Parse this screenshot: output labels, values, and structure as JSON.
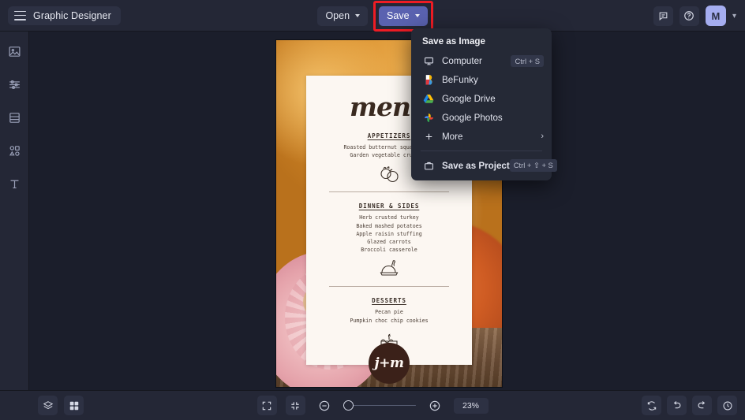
{
  "app": {
    "brand": "Graphic Designer",
    "hamburger_icon": "hamburger-menu-icon"
  },
  "toolbar": {
    "open_label": "Open",
    "save_label": "Save",
    "open_chevron_icon": "chevron-down-icon",
    "save_chevron_icon": "chevron-down-icon",
    "highlight_color": "#ee1c24",
    "save_button_color": "#5a62b0"
  },
  "header_right": {
    "feedback_icon": "comment-icon",
    "help_icon": "help-circle-icon",
    "avatar_initial": "M",
    "avatar_color": "#a5adf0",
    "avatar_chevron_icon": "chevron-down-icon"
  },
  "sidebar": {
    "items": [
      {
        "name": "image",
        "icon": "image-icon"
      },
      {
        "name": "edit",
        "icon": "sliders-icon"
      },
      {
        "name": "templates",
        "icon": "layout-icon"
      },
      {
        "name": "graphics",
        "icon": "shapes-icon"
      },
      {
        "name": "text",
        "icon": "text-icon"
      }
    ]
  },
  "save_menu": {
    "title": "Save as Image",
    "items": [
      {
        "label": "Computer",
        "icon": "monitor-icon",
        "shortcut": "Ctrl + S",
        "arrow": false,
        "bold": false
      },
      {
        "label": "BeFunky",
        "icon": "befunky-logo-icon",
        "shortcut": "",
        "arrow": false,
        "bold": false
      },
      {
        "label": "Google Drive",
        "icon": "google-drive-icon",
        "shortcut": "",
        "arrow": false,
        "bold": false
      },
      {
        "label": "Google Photos",
        "icon": "google-photos-icon",
        "shortcut": "",
        "arrow": false,
        "bold": false
      },
      {
        "label": "More",
        "icon": "plus-icon",
        "shortcut": "",
        "arrow": true,
        "bold": false
      }
    ],
    "project_item": {
      "label": "Save as Project",
      "icon": "briefcase-icon",
      "shortcut": "Ctrl + ⇧ + S"
    }
  },
  "design": {
    "title": "menu",
    "logo": "j+m",
    "sections": [
      {
        "heading": "APPETIZERS",
        "lines": "Roasted butternut squash soup\nGarden vegetable crudites",
        "icon": "squash-vegetables-icon"
      },
      {
        "heading": "DINNER & SIDES",
        "lines": "Herb crusted turkey\nBaked mashed potatoes\nApple raisin stuffing\nGlazed carrots\nBroccoli casserole",
        "icon": "roast-turkey-icon"
      },
      {
        "heading": "DESSERTS",
        "lines": "Pecan pie\nPumpkin choc chip cookies",
        "icon": "cake-icon"
      }
    ]
  },
  "bottombar": {
    "layers_icon": "layers-icon",
    "grid_icon": "grid-icon",
    "fit_icon": "fit-screen-icon",
    "collapse_icon": "collapse-screen-icon",
    "zoom_out_icon": "zoom-out-icon",
    "zoom_in_icon": "zoom-in-icon",
    "zoom_level": "23%",
    "reset_icon": "reset-icon",
    "undo_icon": "undo-icon",
    "redo_icon": "redo-icon",
    "history_icon": "history-icon"
  }
}
